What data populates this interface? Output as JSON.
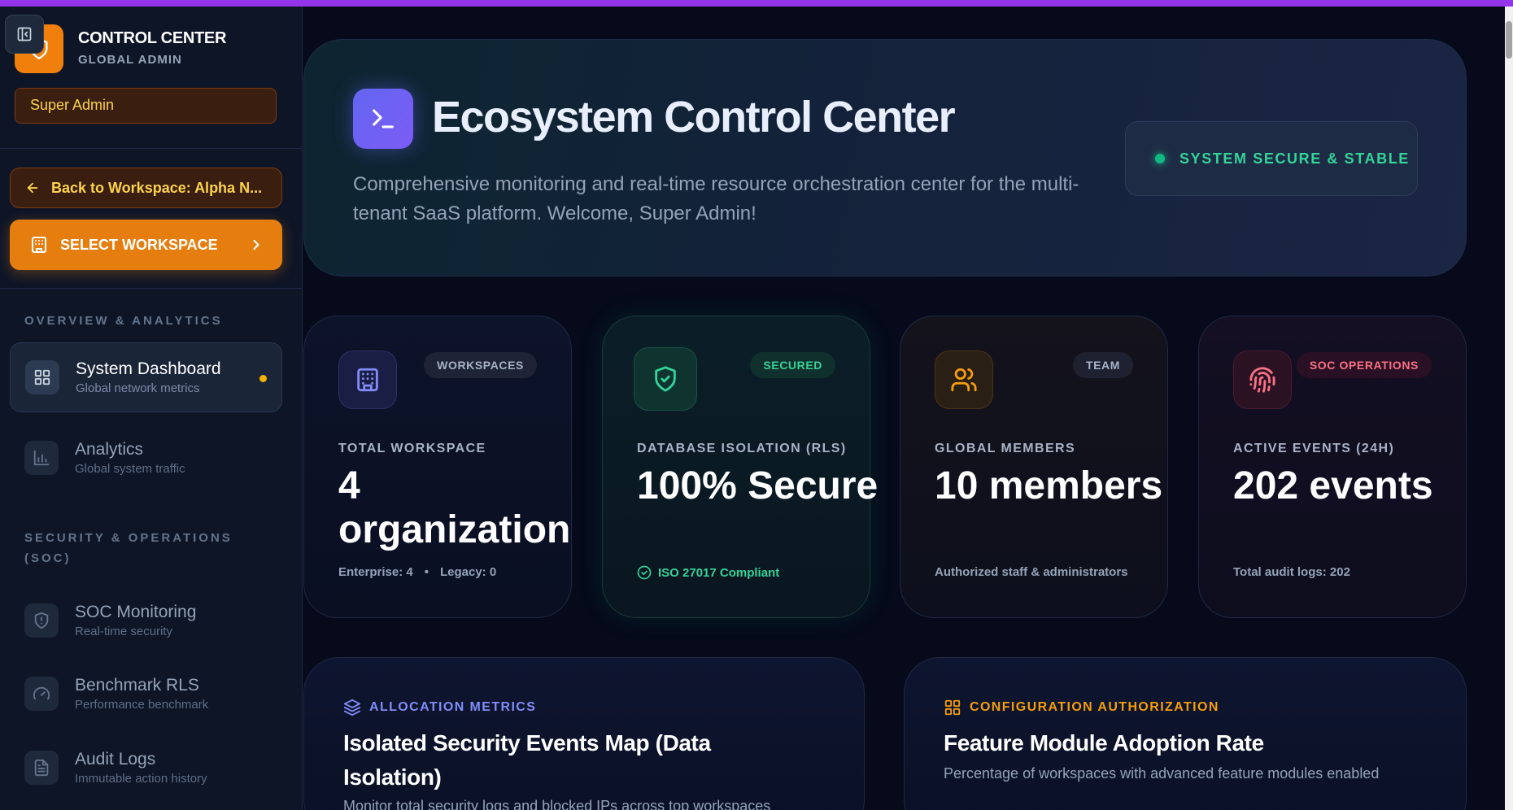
{
  "sidebar": {
    "brand_title": "CONTROL CENTER",
    "brand_subtitle": "GLOBAL ADMIN",
    "role": "Super Admin",
    "back_label": "Back to Workspace: Alpha N...",
    "select_workspace_label": "SELECT WORKSPACE",
    "sections": [
      {
        "label": "OVERVIEW & ANALYTICS"
      },
      {
        "label": "SECURITY & OPERATIONS (SOC)"
      }
    ],
    "items": [
      {
        "title": "System Dashboard",
        "sub": "Global network metrics",
        "icon": "grid-icon",
        "active": true
      },
      {
        "title": "Analytics",
        "sub": "Global system traffic",
        "icon": "bar-chart-icon"
      },
      {
        "title": "SOC Monitoring",
        "sub": "Real-time security",
        "icon": "shield-alert-icon"
      },
      {
        "title": "Benchmark RLS",
        "sub": "Performance benchmark",
        "icon": "gauge-icon"
      },
      {
        "title": "Audit Logs",
        "sub": "Immutable action history",
        "icon": "file-text-icon"
      }
    ]
  },
  "hero": {
    "title": "Ecosystem Control Center",
    "description": "Comprehensive monitoring and real-time resource orchestration center for the multi-tenant SaaS platform. Welcome, Super Admin!",
    "status": "SYSTEM SECURE & STABLE"
  },
  "cards": [
    {
      "badge": "WORKSPACES",
      "label": "TOTAL WORKSPACE",
      "value": "4 organization",
      "foot_a": "Enterprise: 4",
      "foot_sep": "•",
      "foot_b": "Legacy: 0",
      "icon": "building-icon"
    },
    {
      "badge": "SECURED",
      "label": "DATABASE ISOLATION (RLS)",
      "value": "100% Secure",
      "foot": "ISO 27017 Compliant",
      "icon": "shield-check-icon"
    },
    {
      "badge": "TEAM",
      "label": "GLOBAL MEMBERS",
      "value": "10 members",
      "foot": "Authorized staff & administrators",
      "icon": "users-icon"
    },
    {
      "badge": "SOC OPERATIONS",
      "label": "ACTIVE EVENTS (24H)",
      "value": "202 events",
      "foot": "Total audit logs: 202",
      "icon": "fingerprint-icon"
    }
  ],
  "panels": [
    {
      "kicker": "ALLOCATION METRICS",
      "title": "Isolated Security Events Map (Data Isolation)",
      "sub": "Monitor total security logs and blocked IPs across top workspaces",
      "icon": "layers-icon"
    },
    {
      "kicker": "CONFIGURATION AUTHORIZATION",
      "title": "Feature Module Adoption Rate",
      "sub": "Percentage of workspaces with advanced feature modules enabled",
      "icon": "grid-icon"
    }
  ],
  "colors": {
    "accent_purple": "#9333ea",
    "brand_orange": "#e67e0f",
    "success": "#10b981",
    "indigo": "#6366f1",
    "amber": "#f59e0b",
    "pink": "#f43f5e"
  }
}
